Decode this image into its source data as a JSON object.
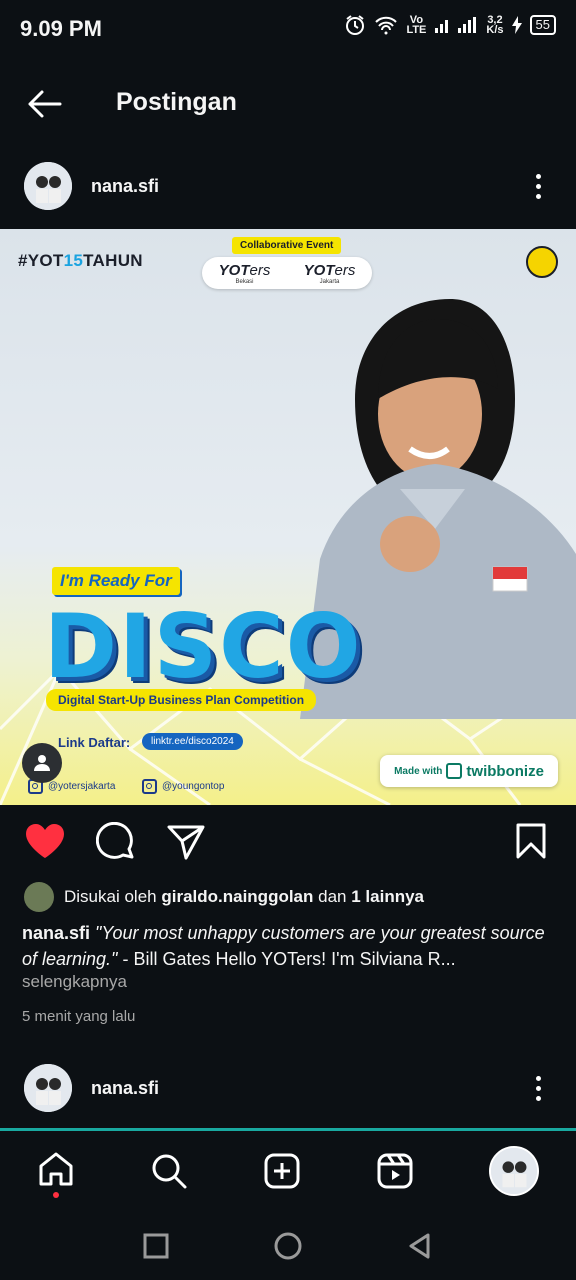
{
  "status_bar": {
    "time": "9.09 PM",
    "network_top": "Vo",
    "network_bottom": "LTE",
    "speed_top": "3,2",
    "speed_bottom": "K/s",
    "battery": "55"
  },
  "header": {
    "title": "Postingan"
  },
  "post": {
    "username": "nana.sfi",
    "image": {
      "hashtag_prefix": "#YOT",
      "hashtag_num": "15",
      "hashtag_suffix": "TAHUN",
      "collab_label": "Collaborative Event",
      "yoters_left": "YOT",
      "yoters_left_suffix": "ers",
      "yoters_left_city": "Bekasi",
      "yoters_right": "YOT",
      "yoters_right_suffix": "ers",
      "yoters_right_city": "Jakarta",
      "ready_label": "I'm Ready For",
      "headline": "DISCO",
      "subtitle": "Digital Start-Up Business Plan Competition",
      "link_label": "Link Daftar:",
      "link_url": "linktr.ee/disco2024",
      "ig_handle_1": "@yotersjakarta",
      "ig_handle_2": "@youngontop",
      "made_with": "Made with",
      "brand": "twibbonize"
    },
    "likes": {
      "prefix": "Disukai oleh",
      "user": "giraldo.nainggolan",
      "middle": "dan",
      "others": "1 lainnya"
    },
    "caption": {
      "user": "nana.sfi",
      "quote": "\"Your most unhappy customers are your greatest source of learning.\"",
      "rest": " - Bill Gates Hello YOTers! I'm Silviana R..."
    },
    "more": "selengkapnya",
    "time": "5 menit yang lalu"
  },
  "next_post": {
    "username": "nana.sfi"
  },
  "colors": {
    "like_red": "#ff3040",
    "background": "#0c1014",
    "nav_accent": "#19a9a0"
  }
}
